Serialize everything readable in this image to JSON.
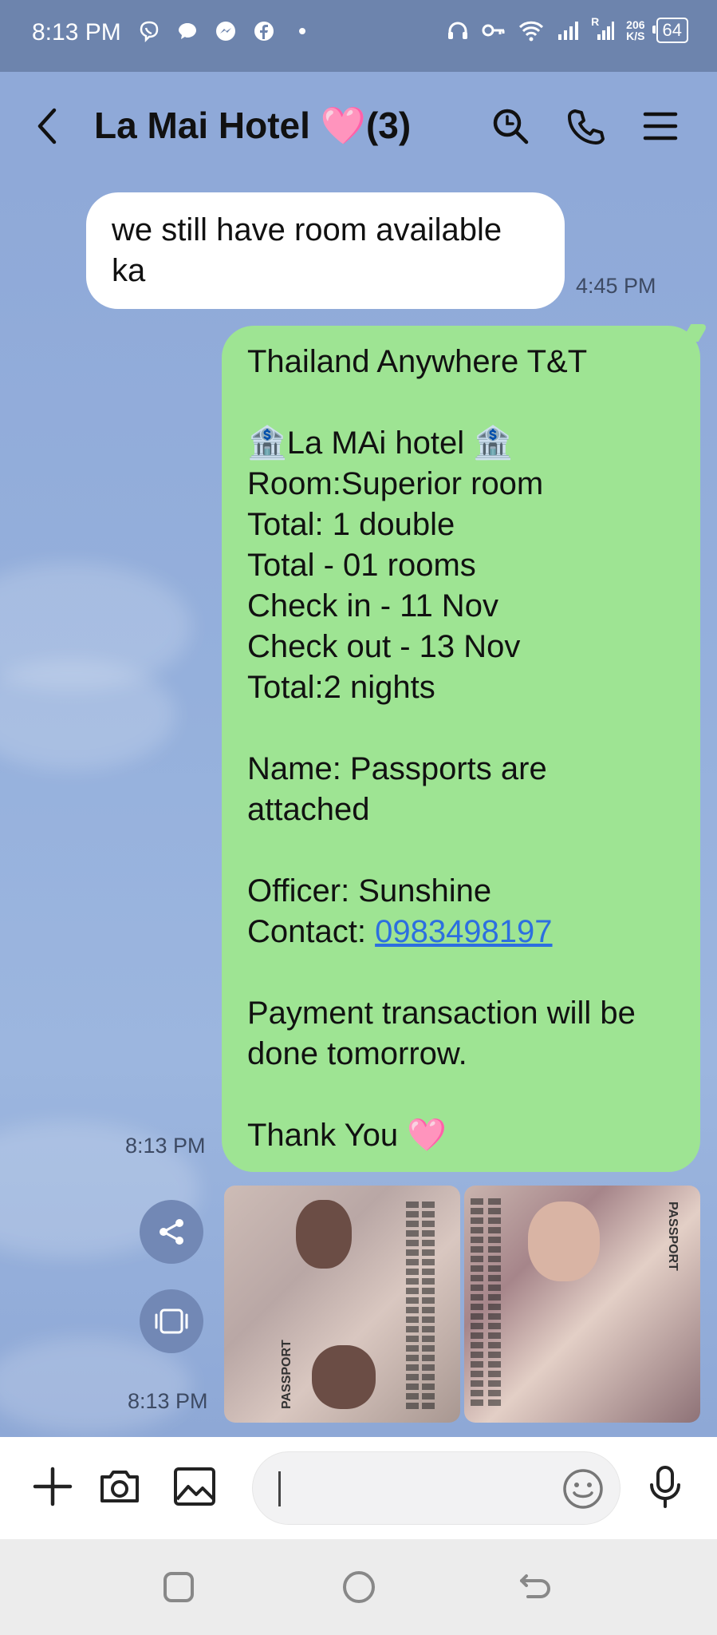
{
  "status_bar": {
    "time": "8:13 PM",
    "notification_icons": [
      "viber-icon",
      "chat-bubble-icon",
      "messenger-icon",
      "facebook-icon",
      "dot-icon"
    ],
    "speed_value": "206",
    "speed_unit": "K/S",
    "battery": "64",
    "signal_roaming": "R"
  },
  "header": {
    "title": "La Mai Hotel 🩷(3)",
    "icons": [
      "back-icon",
      "search-icon",
      "call-icon",
      "menu-icon"
    ]
  },
  "messages": {
    "incoming": {
      "text": "we still have room available ka",
      "time": "4:45 PM"
    },
    "outgoing": {
      "lines": [
        "Thailand Anywhere T&T",
        "",
        "🏦La MAi hotel 🏦",
        "Room:Superior room",
        "Total: 1 double",
        "Total - 01 rooms",
        "Check in - 11 Nov",
        "Check out - 13 Nov",
        "Total:2 nights",
        "",
        "Name: Passports are",
        "attached",
        "",
        "Officer: Sunshine"
      ],
      "contact_label": "Contact: ",
      "contact_number": "0983498197",
      "lines_after": [
        "",
        "Payment transaction will be",
        "done tomorrow.",
        "",
        "Thank You 🩷"
      ],
      "time": "8:13 PM"
    },
    "photos": {
      "time": "8:13 PM",
      "photo1_label": "PASSPORT",
      "photo2_label": "PASSPORT"
    }
  },
  "input_bar": {
    "placeholder": "",
    "icons": [
      "plus-icon",
      "camera-icon",
      "image-icon",
      "emoji-icon",
      "microphone-icon"
    ]
  },
  "nav_bar": {
    "icons": [
      "recent-apps-icon",
      "home-icon",
      "back-nav-icon"
    ]
  },
  "colors": {
    "background": "#8fa9d8",
    "outgoing_bubble": "#9ee493",
    "incoming_bubble": "#ffffff",
    "link": "#2c6fe0"
  }
}
